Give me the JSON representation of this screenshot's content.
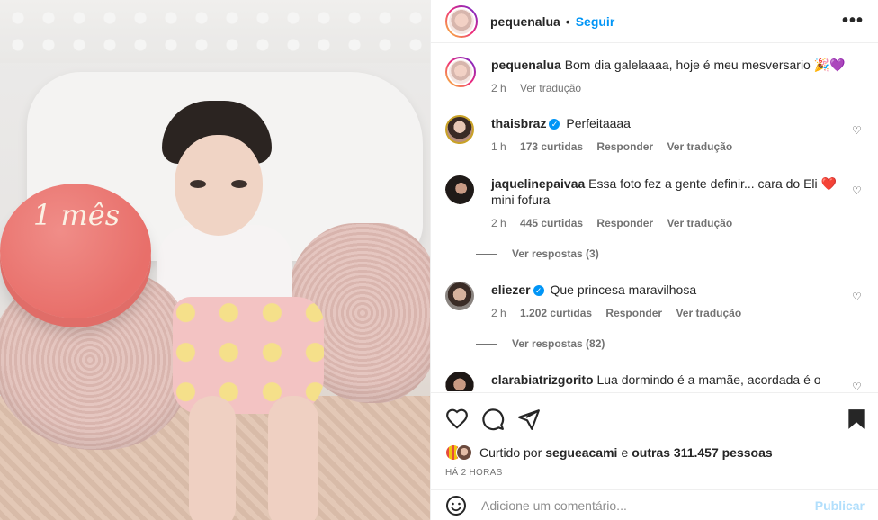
{
  "post": {
    "author": "pequenalua",
    "follow_label": "Seguir",
    "separator": "•",
    "more_label": "•••"
  },
  "caption": {
    "username": "pequenalua",
    "text": "Bom dia galelaaaa, hoje é meu mesversario 🎉💜",
    "time": "2 h",
    "translate": "Ver tradução"
  },
  "comments": [
    {
      "username": "thaisbraz",
      "verified": true,
      "text": "Perfeitaaaa",
      "time": "1 h",
      "likes": "173 curtidas",
      "reply": "Responder",
      "translate": "Ver tradução"
    },
    {
      "username": "jaquelinepaivaa",
      "verified": false,
      "text": "Essa foto fez a gente definir... cara do Eli ❤️ mini fofura",
      "time": "2 h",
      "likes": "445 curtidas",
      "reply": "Responder",
      "translate": "Ver tradução",
      "view_replies": "Ver respostas (3)"
    },
    {
      "username": "eliezer",
      "verified": true,
      "text": "Que princesa maravilhosa",
      "time": "2 h",
      "likes": "1.202 curtidas",
      "reply": "Responder",
      "translate": "Ver tradução",
      "view_replies": "Ver respostas (82)"
    },
    {
      "username": "clarabiatrizgorito",
      "verified": false,
      "text": "Lua dormindo é a mamãe, acordada é o"
    }
  ],
  "liked_by": {
    "prefix": "Curtido por",
    "user": "segueacami",
    "connector": "e",
    "others": "outras 311.457 pessoas"
  },
  "posted_time": "HÁ 2 HORAS",
  "comment_input": {
    "placeholder": "Adicione um comentário..."
  },
  "publish_label": "Publicar",
  "photo": {
    "cake_text": "1 mês"
  },
  "icons": [
    "heart-icon",
    "comment-icon",
    "share-icon",
    "bookmark-icon",
    "emoji-icon",
    "more-icon",
    "verified-icon"
  ],
  "colors": {
    "accent": "#0095f6",
    "publish_disabled": "#b2dffc",
    "secondary_text": "#737373"
  }
}
